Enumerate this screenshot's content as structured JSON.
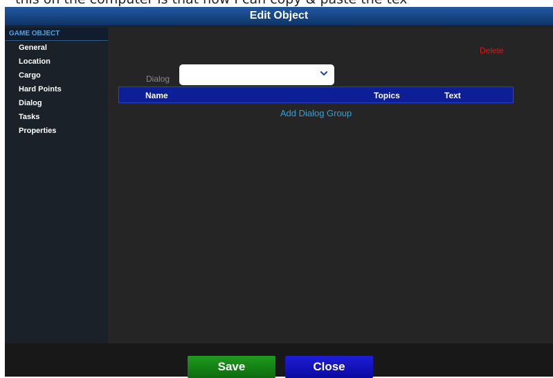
{
  "page_caption": "this on the computer is that now I can copy & paste the tex",
  "window": {
    "title": "Edit Object"
  },
  "sidebar": {
    "header": "GAME OBJECT",
    "items": [
      {
        "label": "General"
      },
      {
        "label": "Location"
      },
      {
        "label": "Cargo"
      },
      {
        "label": "Hard Points"
      },
      {
        "label": "Dialog"
      },
      {
        "label": "Tasks"
      },
      {
        "label": "Properties"
      }
    ]
  },
  "main": {
    "delete_label": "Delete",
    "dialog_label": "Dialog",
    "dialog_select_value": "",
    "table": {
      "columns": [
        "Name",
        "Topics",
        "Text"
      ]
    },
    "add_dialog_group_label": "Add Dialog Group"
  },
  "footer": {
    "save_label": "Save",
    "close_label": "Close"
  },
  "colors": {
    "accent_blue": "#0d1f96",
    "delete_red": "#e01414",
    "link_blue": "#29a3e0",
    "save_green": "#1f9a1f",
    "close_blue": "#1d1dd6"
  }
}
